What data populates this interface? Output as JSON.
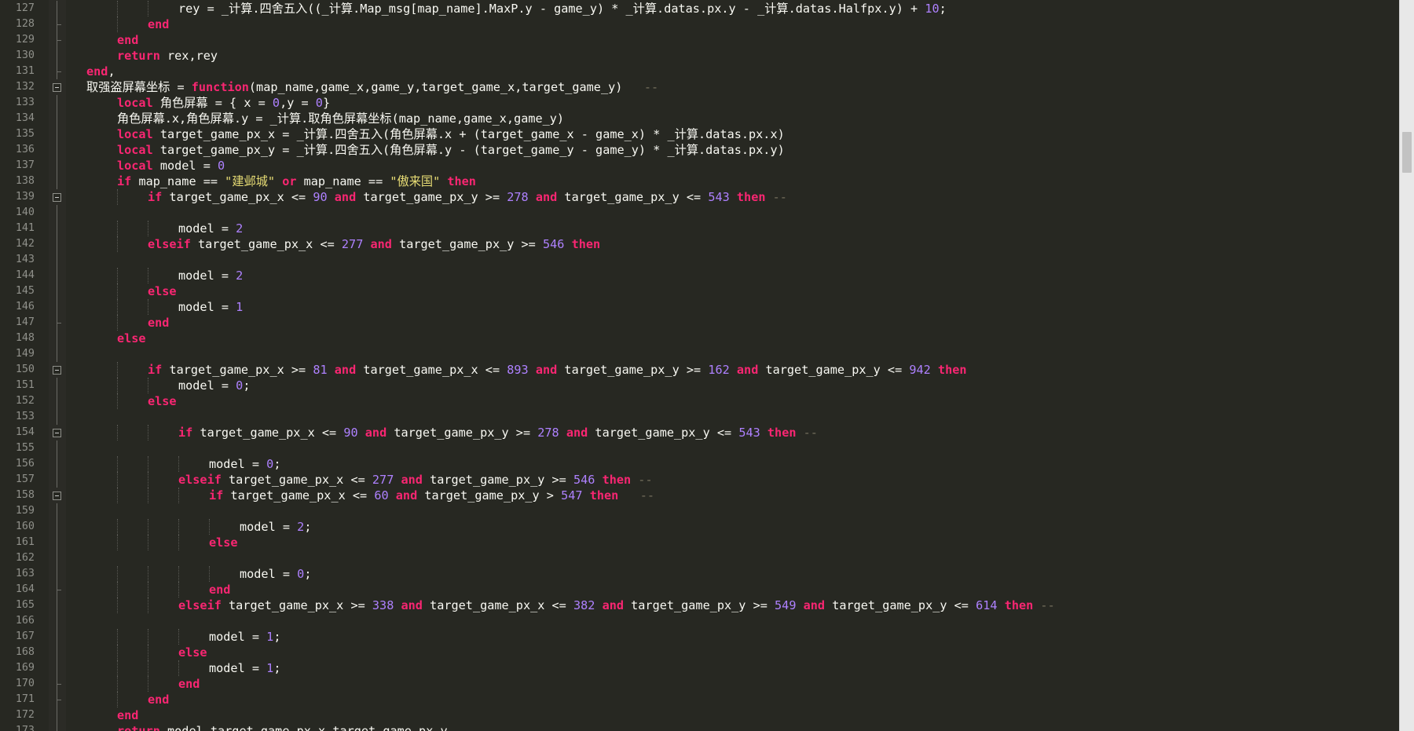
{
  "editor": {
    "line_numbers": [
      "127",
      "128",
      "129",
      "130",
      "131",
      "132",
      "133",
      "134",
      "135",
      "136",
      "137",
      "138",
      "139",
      "140",
      "141",
      "142",
      "143",
      "144",
      "145",
      "146",
      "147",
      "148",
      "149",
      "150",
      "151",
      "152",
      "153",
      "154",
      "155",
      "156",
      "157",
      "158",
      "159",
      "160",
      "161",
      "162",
      "163",
      "164",
      "165",
      "166",
      "167",
      "168",
      "169",
      "170",
      "171",
      "172",
      "173"
    ],
    "lines": [
      {
        "indent": 3,
        "tokens": [
          [
            "id",
            "rey = _计算.四舍五入((_计算.Map_msg[map_name].MaxP.y - game_y) * _计算.datas.px.y - _计算.datas.Halfpx.y) + "
          ],
          [
            "num",
            "10"
          ],
          [
            "op",
            ";"
          ]
        ]
      },
      {
        "indent": 2,
        "tokens": [
          [
            "kw",
            "end"
          ]
        ]
      },
      {
        "indent": 1,
        "tokens": [
          [
            "kw",
            "end"
          ]
        ]
      },
      {
        "indent": 1,
        "tokens": [
          [
            "kw",
            "return"
          ],
          [
            "id",
            " rex,rey"
          ]
        ]
      },
      {
        "indent": 0,
        "tokens": [
          [
            "kw",
            "end"
          ],
          [
            "op",
            ","
          ]
        ]
      },
      {
        "indent": 0,
        "tokens": [
          [
            "id",
            "取强盗屏幕坐标 = "
          ],
          [
            "kw",
            "function"
          ],
          [
            "id",
            "(map_name,game_x,game_y,target_game_x,target_game_y)   "
          ],
          [
            "cm",
            "--"
          ]
        ]
      },
      {
        "indent": 1,
        "tokens": [
          [
            "kw",
            "local"
          ],
          [
            "id",
            " 角色屏幕 = { x = "
          ],
          [
            "num",
            "0"
          ],
          [
            "id",
            ",y = "
          ],
          [
            "num",
            "0"
          ],
          [
            "id",
            "}"
          ]
        ]
      },
      {
        "indent": 1,
        "tokens": [
          [
            "id",
            "角色屏幕.x,角色屏幕.y = _计算.取角色屏幕坐标(map_name,game_x,game_y)"
          ]
        ]
      },
      {
        "indent": 1,
        "tokens": [
          [
            "kw",
            "local"
          ],
          [
            "id",
            " target_game_px_x = _计算.四舍五入(角色屏幕.x + (target_game_x - game_x) * _计算.datas.px.x)"
          ]
        ]
      },
      {
        "indent": 1,
        "tokens": [
          [
            "kw",
            "local"
          ],
          [
            "id",
            " target_game_px_y = _计算.四舍五入(角色屏幕.y - (target_game_y - game_y) * _计算.datas.px.y)"
          ]
        ]
      },
      {
        "indent": 1,
        "tokens": [
          [
            "kw",
            "local"
          ],
          [
            "id",
            " model = "
          ],
          [
            "num",
            "0"
          ]
        ]
      },
      {
        "indent": 1,
        "tokens": [
          [
            "kw",
            "if"
          ],
          [
            "id",
            " map_name == "
          ],
          [
            "str",
            "\"建邺城\""
          ],
          [
            "id",
            " "
          ],
          [
            "kw",
            "or"
          ],
          [
            "id",
            " map_name == "
          ],
          [
            "str",
            "\"傲来国\""
          ],
          [
            "id",
            " "
          ],
          [
            "kw",
            "then"
          ]
        ]
      },
      {
        "indent": 2,
        "tokens": [
          [
            "kw",
            "if"
          ],
          [
            "id",
            " target_game_px_x <= "
          ],
          [
            "num",
            "90"
          ],
          [
            "id",
            " "
          ],
          [
            "kw",
            "and"
          ],
          [
            "id",
            " target_game_px_y >= "
          ],
          [
            "num",
            "278"
          ],
          [
            "id",
            " "
          ],
          [
            "kw",
            "and"
          ],
          [
            "id",
            " target_game_px_y <= "
          ],
          [
            "num",
            "543"
          ],
          [
            "id",
            " "
          ],
          [
            "kw",
            "then"
          ],
          [
            "id",
            " "
          ],
          [
            "cm",
            "--"
          ]
        ]
      },
      {
        "indent": 0,
        "tokens": []
      },
      {
        "indent": 3,
        "tokens": [
          [
            "id",
            "model = "
          ],
          [
            "num",
            "2"
          ]
        ]
      },
      {
        "indent": 2,
        "tokens": [
          [
            "kw",
            "elseif"
          ],
          [
            "id",
            " target_game_px_x <= "
          ],
          [
            "num",
            "277"
          ],
          [
            "id",
            " "
          ],
          [
            "kw",
            "and"
          ],
          [
            "id",
            " target_game_px_y >= "
          ],
          [
            "num",
            "546"
          ],
          [
            "id",
            " "
          ],
          [
            "kw",
            "then"
          ]
        ]
      },
      {
        "indent": 0,
        "tokens": []
      },
      {
        "indent": 3,
        "tokens": [
          [
            "id",
            "model = "
          ],
          [
            "num",
            "2"
          ]
        ]
      },
      {
        "indent": 2,
        "tokens": [
          [
            "kw",
            "else"
          ]
        ]
      },
      {
        "indent": 3,
        "tokens": [
          [
            "id",
            "model = "
          ],
          [
            "num",
            "1"
          ]
        ]
      },
      {
        "indent": 2,
        "tokens": [
          [
            "kw",
            "end"
          ]
        ]
      },
      {
        "indent": 1,
        "tokens": [
          [
            "kw",
            "else"
          ]
        ]
      },
      {
        "indent": 0,
        "tokens": []
      },
      {
        "indent": 2,
        "tokens": [
          [
            "kw",
            "if"
          ],
          [
            "id",
            " target_game_px_x >= "
          ],
          [
            "num",
            "81"
          ],
          [
            "id",
            " "
          ],
          [
            "kw",
            "and"
          ],
          [
            "id",
            " target_game_px_x <= "
          ],
          [
            "num",
            "893"
          ],
          [
            "id",
            " "
          ],
          [
            "kw",
            "and"
          ],
          [
            "id",
            " target_game_px_y >= "
          ],
          [
            "num",
            "162"
          ],
          [
            "id",
            " "
          ],
          [
            "kw",
            "and"
          ],
          [
            "id",
            " target_game_px_y <= "
          ],
          [
            "num",
            "942"
          ],
          [
            "id",
            " "
          ],
          [
            "kw",
            "then"
          ]
        ]
      },
      {
        "indent": 3,
        "tokens": [
          [
            "id",
            "model = "
          ],
          [
            "num",
            "0"
          ],
          [
            "op",
            ";"
          ]
        ]
      },
      {
        "indent": 2,
        "tokens": [
          [
            "kw",
            "else"
          ]
        ]
      },
      {
        "indent": 0,
        "tokens": []
      },
      {
        "indent": 3,
        "tokens": [
          [
            "kw",
            "if"
          ],
          [
            "id",
            " target_game_px_x <= "
          ],
          [
            "num",
            "90"
          ],
          [
            "id",
            " "
          ],
          [
            "kw",
            "and"
          ],
          [
            "id",
            " target_game_px_y >= "
          ],
          [
            "num",
            "278"
          ],
          [
            "id",
            " "
          ],
          [
            "kw",
            "and"
          ],
          [
            "id",
            " target_game_px_y <= "
          ],
          [
            "num",
            "543"
          ],
          [
            "id",
            " "
          ],
          [
            "kw",
            "then"
          ],
          [
            "id",
            " "
          ],
          [
            "cm",
            "--"
          ]
        ]
      },
      {
        "indent": 0,
        "tokens": []
      },
      {
        "indent": 4,
        "tokens": [
          [
            "id",
            "model = "
          ],
          [
            "num",
            "0"
          ],
          [
            "op",
            ";"
          ]
        ]
      },
      {
        "indent": 3,
        "tokens": [
          [
            "kw",
            "elseif"
          ],
          [
            "id",
            " target_game_px_x <= "
          ],
          [
            "num",
            "277"
          ],
          [
            "id",
            " "
          ],
          [
            "kw",
            "and"
          ],
          [
            "id",
            " target_game_px_y >= "
          ],
          [
            "num",
            "546"
          ],
          [
            "id",
            " "
          ],
          [
            "kw",
            "then"
          ],
          [
            "id",
            " "
          ],
          [
            "cm",
            "--"
          ]
        ]
      },
      {
        "indent": 4,
        "tokens": [
          [
            "kw",
            "if"
          ],
          [
            "id",
            " target_game_px_x <= "
          ],
          [
            "num",
            "60"
          ],
          [
            "id",
            " "
          ],
          [
            "kw",
            "and"
          ],
          [
            "id",
            " target_game_px_y > "
          ],
          [
            "num",
            "547"
          ],
          [
            "id",
            " "
          ],
          [
            "kw",
            "then"
          ],
          [
            "id",
            "   "
          ],
          [
            "cm",
            "--"
          ]
        ]
      },
      {
        "indent": 0,
        "tokens": []
      },
      {
        "indent": 5,
        "tokens": [
          [
            "id",
            "model = "
          ],
          [
            "num",
            "2"
          ],
          [
            "op",
            ";"
          ]
        ]
      },
      {
        "indent": 4,
        "tokens": [
          [
            "kw",
            "else"
          ]
        ]
      },
      {
        "indent": 0,
        "tokens": []
      },
      {
        "indent": 5,
        "tokens": [
          [
            "id",
            "model = "
          ],
          [
            "num",
            "0"
          ],
          [
            "op",
            ";"
          ]
        ]
      },
      {
        "indent": 4,
        "tokens": [
          [
            "kw",
            "end"
          ]
        ]
      },
      {
        "indent": 3,
        "tokens": [
          [
            "kw",
            "elseif"
          ],
          [
            "id",
            " target_game_px_x >= "
          ],
          [
            "num",
            "338"
          ],
          [
            "id",
            " "
          ],
          [
            "kw",
            "and"
          ],
          [
            "id",
            " target_game_px_x <= "
          ],
          [
            "num",
            "382"
          ],
          [
            "id",
            " "
          ],
          [
            "kw",
            "and"
          ],
          [
            "id",
            " target_game_px_y >= "
          ],
          [
            "num",
            "549"
          ],
          [
            "id",
            " "
          ],
          [
            "kw",
            "and"
          ],
          [
            "id",
            " target_game_px_y <= "
          ],
          [
            "num",
            "614"
          ],
          [
            "id",
            " "
          ],
          [
            "kw",
            "then"
          ],
          [
            "id",
            " "
          ],
          [
            "cm",
            "--"
          ]
        ]
      },
      {
        "indent": 0,
        "tokens": []
      },
      {
        "indent": 4,
        "tokens": [
          [
            "id",
            "model = "
          ],
          [
            "num",
            "1"
          ],
          [
            "op",
            ";"
          ]
        ]
      },
      {
        "indent": 3,
        "tokens": [
          [
            "kw",
            "else"
          ]
        ]
      },
      {
        "indent": 4,
        "tokens": [
          [
            "id",
            "model = "
          ],
          [
            "num",
            "1"
          ],
          [
            "op",
            ";"
          ]
        ]
      },
      {
        "indent": 3,
        "tokens": [
          [
            "kw",
            "end"
          ]
        ]
      },
      {
        "indent": 2,
        "tokens": [
          [
            "kw",
            "end"
          ]
        ]
      },
      {
        "indent": 1,
        "tokens": [
          [
            "kw",
            "end"
          ]
        ]
      },
      {
        "indent": 1,
        "tokens": [
          [
            "kw",
            "return"
          ],
          [
            "id",
            " model,target_game_px_x,target_game_px_y"
          ]
        ]
      }
    ],
    "fold_markers": [
      "132",
      "139",
      "150",
      "154",
      "158"
    ],
    "fold_ends": [
      "128",
      "129",
      "131",
      "147",
      "164",
      "170",
      "171"
    ]
  },
  "scrollbar": {
    "position_fraction": 0.18
  }
}
